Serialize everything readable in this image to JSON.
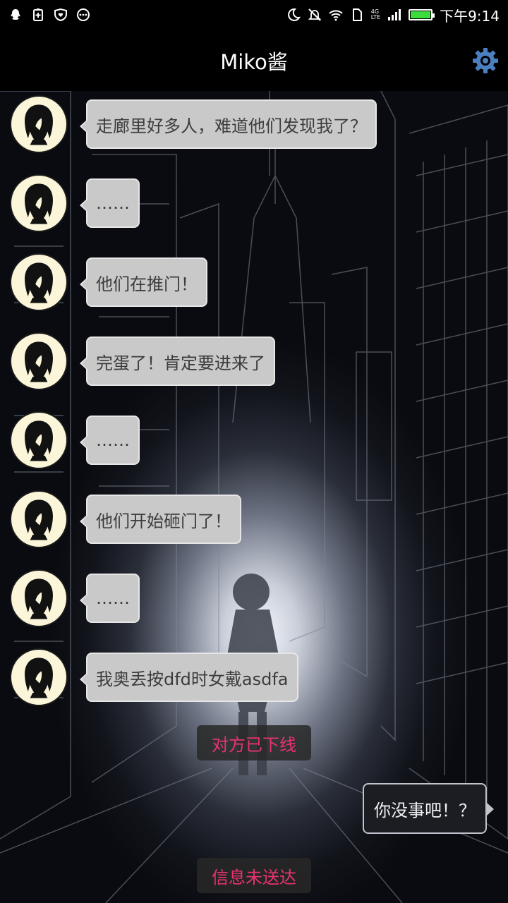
{
  "status_bar": {
    "time": "下午9:14",
    "network_type_top": "4G",
    "network_type_bottom": "LTE",
    "icons_left": [
      "qq-icon",
      "battery-saver-icon",
      "heart-shield-icon",
      "more-circle-icon"
    ],
    "icons_right": [
      "moon-icon",
      "mute-icon",
      "wifi-icon",
      "sim-icon",
      "signal-icon",
      "battery-icon"
    ],
    "battery_level": 1.0,
    "battery_color": "#3ddc3d"
  },
  "header": {
    "title": "Miko酱",
    "settings_icon": "gear-icon",
    "settings_color": "#4a7fc0"
  },
  "messages": [
    {
      "sender": "Miko酱",
      "text": "走廊里好多人，难道他们发现我了？"
    },
    {
      "sender": "Miko酱",
      "text": "……"
    },
    {
      "sender": "Miko酱",
      "text": "他们在推门！"
    },
    {
      "sender": "Miko酱",
      "text": "完蛋了！肯定要进来了"
    },
    {
      "sender": "Miko酱",
      "text": "……"
    },
    {
      "sender": "Miko酱",
      "text": "他们开始砸门了！"
    },
    {
      "sender": "Miko酱",
      "text": "……"
    },
    {
      "sender": "Miko酱",
      "text": "我奥丢按dfd时女戴asdfa"
    }
  ],
  "system_notice_offline": "对方已下线",
  "outgoing_message": "你没事吧！？",
  "system_notice_undelivered": "信息未送达",
  "colors": {
    "notice_text": "#e8336e",
    "incoming_bubble": "#c9c9c9",
    "outgoing_bubble": "#1b1d23"
  }
}
